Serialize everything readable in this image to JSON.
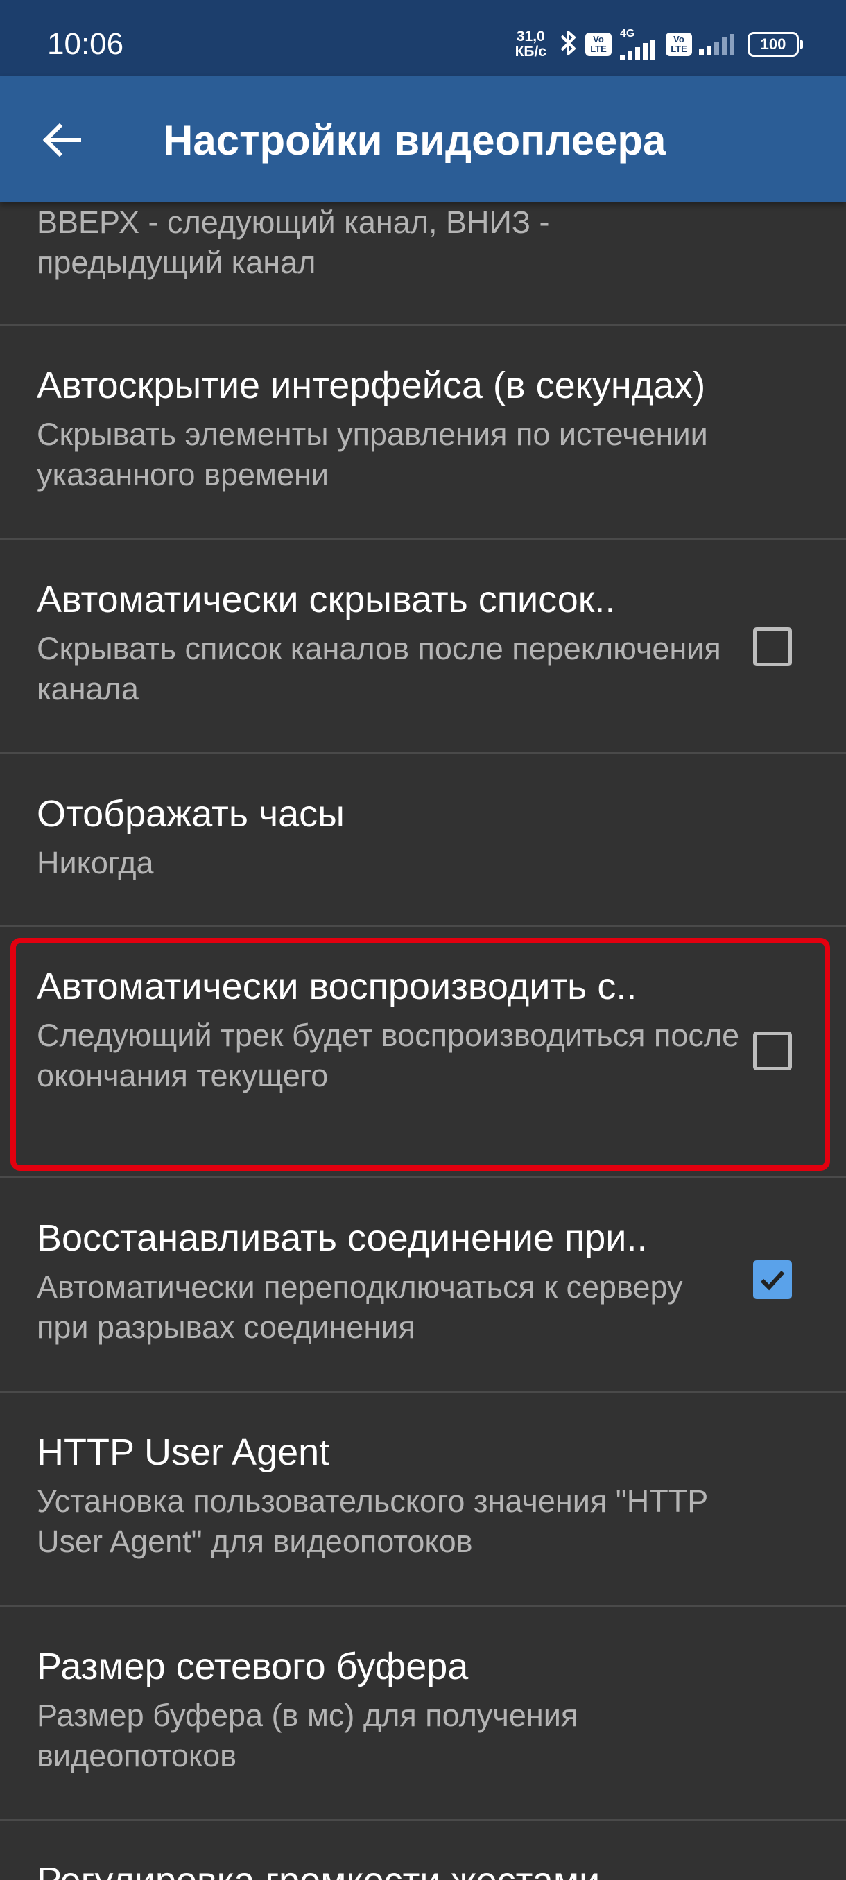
{
  "status_bar": {
    "time": "10:06",
    "net_speed_value": "31,0",
    "net_speed_unit": "КБ/с",
    "network_type": "4G",
    "volte_top": "Vo",
    "volte_bottom": "LTE",
    "battery": "100"
  },
  "app_bar": {
    "title": "Настройки видеоплеера",
    "back_icon": "arrow-left-icon"
  },
  "settings": [
    {
      "title": "",
      "summary": "ВВЕРХ - следующий канал, ВНИЗ - предыдущий канал",
      "checkbox": null
    },
    {
      "title": "Автоскрытие интерфейса (в секундах)",
      "summary": "Скрывать элементы управления по истечении указанного времени",
      "checkbox": null
    },
    {
      "title": "Автоматически скрывать список..",
      "summary": "Скрывать список каналов после переключения канала",
      "checkbox": false
    },
    {
      "title": "Отображать часы",
      "summary": "Никогда",
      "checkbox": null
    },
    {
      "title": "Автоматически воспроизводить с..",
      "summary": "Следующий трек будет воспроизводиться после окончания текущего",
      "checkbox": false,
      "highlighted": true
    },
    {
      "title": "Восстанавливать соединение при..",
      "summary": "Автоматически переподключаться к серверу при разрывах соединения",
      "checkbox": true
    },
    {
      "title": "HTTP User Agent",
      "summary": "Установка пользовательского значения \"HTTP User Agent\" для видеопотоков",
      "checkbox": null
    },
    {
      "title": "Размер сетевого буфера",
      "summary": "Размер буфера (в мс) для получения видеопотоков",
      "checkbox": null
    },
    {
      "title": "Регулировка громкости жестами",
      "summary": "",
      "checkbox": null
    }
  ],
  "colors": {
    "status_bar_bg": "#1c3e6c",
    "app_bar_bg": "#2b5d96",
    "list_bg": "#323232",
    "checkbox_checked": "#5aa2ea",
    "highlight_border": "#e3000f"
  }
}
